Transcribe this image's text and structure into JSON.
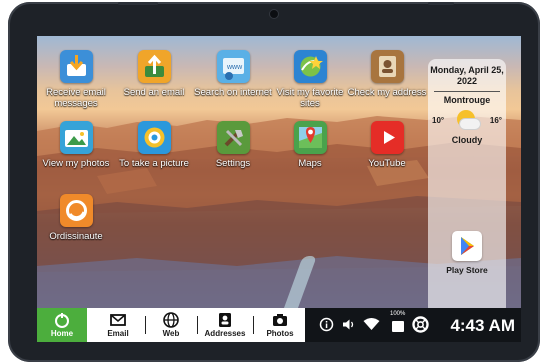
{
  "apps": [
    {
      "id": "receive-email",
      "label": "Receive email messages",
      "icon": "inbox-download-icon",
      "color": "#4a90d9"
    },
    {
      "id": "send-email",
      "label": "Send an email",
      "icon": "outbox-upload-icon",
      "color": "#f5a623"
    },
    {
      "id": "search-internet",
      "label": "Search on internet",
      "icon": "globe-www-icon",
      "color": "#4aa3df"
    },
    {
      "id": "favorite-sites",
      "label": "Visit my favorite sites",
      "icon": "globe-star-icon",
      "color": "#2d8bd6"
    },
    {
      "id": "check-address",
      "label": "Check my address",
      "icon": "address-book-icon",
      "color": "#9b6b3a"
    },
    {
      "id": "photos",
      "label": "View my photos",
      "icon": "photos-icon",
      "color": "#3aa35a"
    },
    {
      "id": "take-picture",
      "label": "To take a picture",
      "icon": "camera-icon",
      "color": "#2f9be0"
    },
    {
      "id": "settings",
      "label": "Settings",
      "icon": "tools-icon",
      "color": "#5a9a3c"
    },
    {
      "id": "maps",
      "label": "Maps",
      "icon": "map-pin-icon",
      "color": "#49a04a"
    },
    {
      "id": "youtube",
      "label": "YouTube",
      "icon": "youtube-play-icon",
      "color": "#e52d27"
    },
    {
      "id": "ordissinaute",
      "label": "Ordissinaute",
      "icon": "ordissinaute-logo-icon",
      "color": "#f08a2a"
    }
  ],
  "panel": {
    "date": "Monday, April 25, 2022",
    "city": "Montrouge",
    "temp_min": "10°",
    "temp_max": "16°",
    "condition": "Cloudy",
    "weather_icon": "partly-cloudy-icon",
    "store_label": "Play Store",
    "store_icon": "play-store-icon"
  },
  "taskbar": {
    "items": [
      {
        "label": "Home",
        "icon": "home-icon",
        "active": true
      },
      {
        "label": "Email",
        "icon": "envelope-icon",
        "active": false
      },
      {
        "label": "Web",
        "icon": "globe-icon",
        "active": false
      },
      {
        "label": "Addresses",
        "icon": "contacts-icon",
        "active": false
      },
      {
        "label": "Photos",
        "icon": "camera-icon",
        "active": false
      }
    ],
    "battery": "100%",
    "time": "4:43 AM",
    "status_icons": [
      "info-icon",
      "volume-icon",
      "wifi-icon",
      "battery-icon",
      "help-lifebuoy-icon"
    ]
  },
  "colors": {
    "home_active": "#4cae3d",
    "taskbar_dark": "#111418",
    "bezel": "#1e2228"
  }
}
